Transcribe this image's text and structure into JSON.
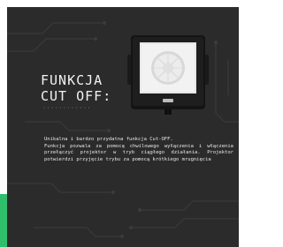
{
  "heading": {
    "line1": "FUNKCJA",
    "line2": "CUT OFF:"
  },
  "dots": "············",
  "description": "Unikalna i bardzo przydatna funkcja Cut-OFF.\nFunkcja pozwala za pomocą chwilowego wyłączenia i włączenia przełączyć projektor w tryb ciągłego działania. Projektor potwierdzi przyjęcie trybu za pomocą krótkiego mrugnięcia",
  "colors": {
    "panel": "#2b2b2b",
    "accent": "#2fbf6b",
    "text": "#f2f2f2",
    "circuit": "#3c3c3c"
  },
  "icons": {
    "product": "led-floodlight-with-motion-sensor"
  }
}
